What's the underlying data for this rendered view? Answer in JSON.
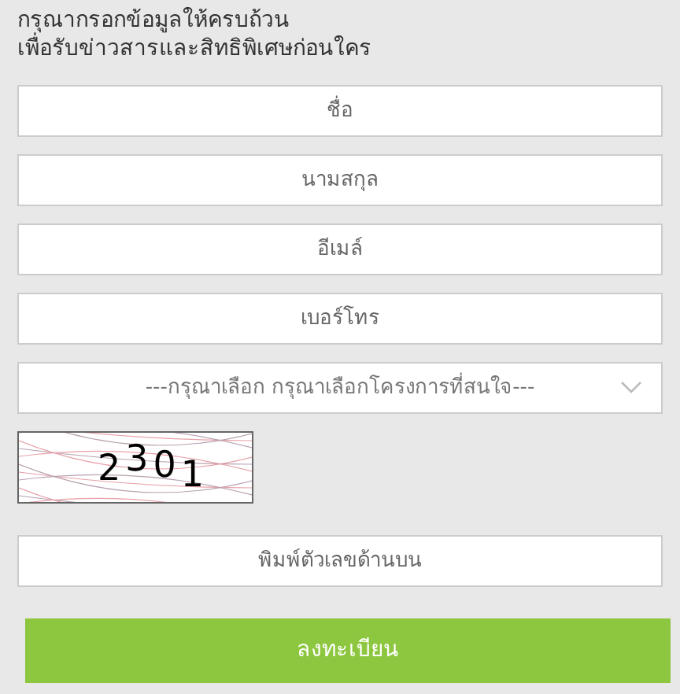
{
  "heading": [
    "กรุณากรอกข้อมูลให้ครบถ้วน",
    "เพื่อรับข่าวสารและสิทธิพิเศษก่อนใคร"
  ],
  "fields": [
    {
      "placeholder": "ชื่อ"
    },
    {
      "placeholder": "นามสกุล"
    },
    {
      "placeholder": "อีเมล์"
    },
    {
      "placeholder": "เบอร์โทร"
    }
  ],
  "project_select": {
    "value": "---กรุณาเลือก กรุณาเลือกโครงการที่สนใจ---"
  },
  "captcha": {
    "code": [
      "2",
      "3",
      "0",
      "1"
    ]
  },
  "captcha_field": {
    "placeholder": "พิมพ์ตัวเลขด้านบน"
  },
  "submit_button": "ลงทะเบียน"
}
